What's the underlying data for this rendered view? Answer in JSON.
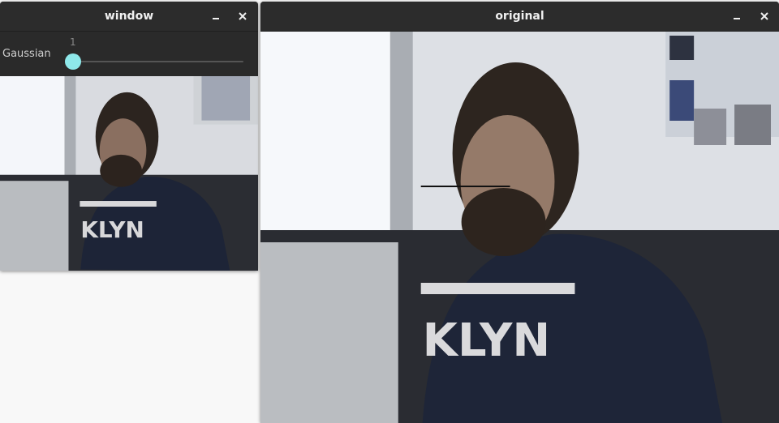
{
  "windows": {
    "left": {
      "title": "window",
      "controls": {
        "minimize": "minimize-icon",
        "close": "close-icon"
      },
      "trackbar": {
        "label": "Gaussian",
        "value": "1",
        "fraction": 0.0
      }
    },
    "right": {
      "title": "original",
      "controls": {
        "minimize": "minimize-icon",
        "close": "close-icon"
      }
    }
  },
  "colors": {
    "titlebar": "#2c2c2c",
    "slider_thumb": "#8ee8ea",
    "desktop": "#f8f8f8"
  }
}
